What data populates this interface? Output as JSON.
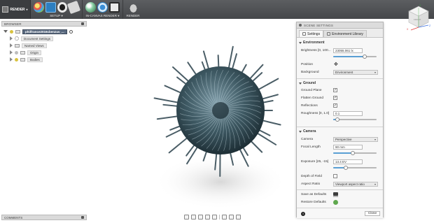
{
  "toolbar": {
    "workspace_label": "RENDER",
    "setup_label": "SETUP",
    "in_canvas_label": "IN-CANVAS RENDER",
    "render_label": "RENDER"
  },
  "browser": {
    "title": "BROWSER",
    "document_name": "philfrance2016cbenzuv_...",
    "items": [
      {
        "label": "Document Settings"
      },
      {
        "label": "Named Views"
      },
      {
        "label": "Origin"
      },
      {
        "label": "Bodies"
      }
    ]
  },
  "comments": {
    "title": "COMMENTS"
  },
  "scene": {
    "title": "SCENE SETTINGS",
    "tabs": [
      {
        "label": "Settings"
      },
      {
        "label": "Environment Library"
      }
    ],
    "environment": {
      "heading": "Environment",
      "brightness_label": "Brightness [0, 100...",
      "brightness_value": "23055.061 lx",
      "brightness_level": 0.72,
      "position_label": "Position",
      "background_label": "Background",
      "background_value": "Environment"
    },
    "ground": {
      "heading": "Ground",
      "ground_plane_label": "Ground Plane",
      "flatten_label": "Flatten Ground",
      "reflections_label": "Reflections",
      "roughness_label": "Roughness [0, 1.0]",
      "roughness_value": "0.1",
      "roughness_level": 0.1
    },
    "camera": {
      "heading": "Camera",
      "camera_label": "Camera",
      "camera_value": "Perspective",
      "focal_label": "Focal Length",
      "focal_value": "90 mm",
      "focal_level": 0.45,
      "exposure_label": "Exposure [25, -15]",
      "exposure_value": "13.4 EV",
      "exposure_level": 0.29,
      "dof_label": "Depth of Field",
      "aspect_label": "Aspect Ratio",
      "aspect_value": "Viewport aspect ratio",
      "save_label": "Save as Defaults",
      "restore_label": "Restore Defaults"
    },
    "close_label": "Close",
    "info_glyph": "i",
    "check_glyph": "✓"
  },
  "viewcube": {
    "front_label": "FRONT",
    "axis_labels": [
      "X",
      "Y",
      "Z"
    ],
    "colors": {
      "x": "#e03b3b",
      "y": "#3bb13b",
      "z": "#3b6fe0"
    }
  }
}
